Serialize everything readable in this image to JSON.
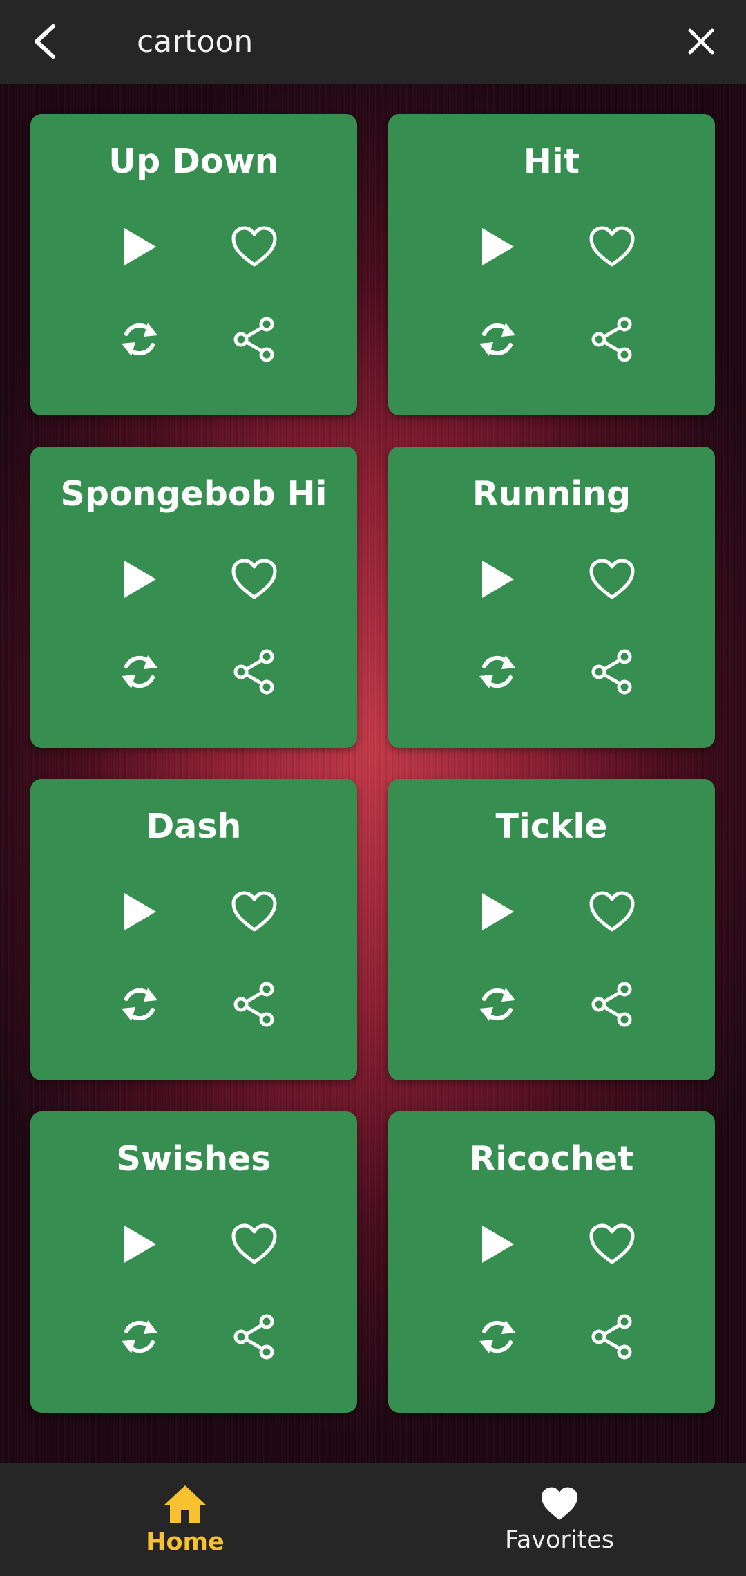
{
  "search": {
    "query": "cartoon"
  },
  "icons": {
    "back": "chevron-left-icon",
    "close": "close-icon",
    "play": "play-icon",
    "favorite": "heart-outline-icon",
    "repeat": "repeat-icon",
    "share": "share-icon",
    "home": "home-icon",
    "favorites_tab": "heart-filled-icon"
  },
  "colors": {
    "card": "#368f50",
    "topbar": "#262626",
    "active_tab": "#f6c230"
  },
  "sounds": [
    {
      "title": "Up Down"
    },
    {
      "title": "Hit"
    },
    {
      "title": "Spongebob Hi"
    },
    {
      "title": "Running"
    },
    {
      "title": "Dash"
    },
    {
      "title": "Tickle"
    },
    {
      "title": "Swishes"
    },
    {
      "title": "Ricochet"
    }
  ],
  "nav": {
    "home_label": "Home",
    "favorites_label": "Favorites"
  }
}
